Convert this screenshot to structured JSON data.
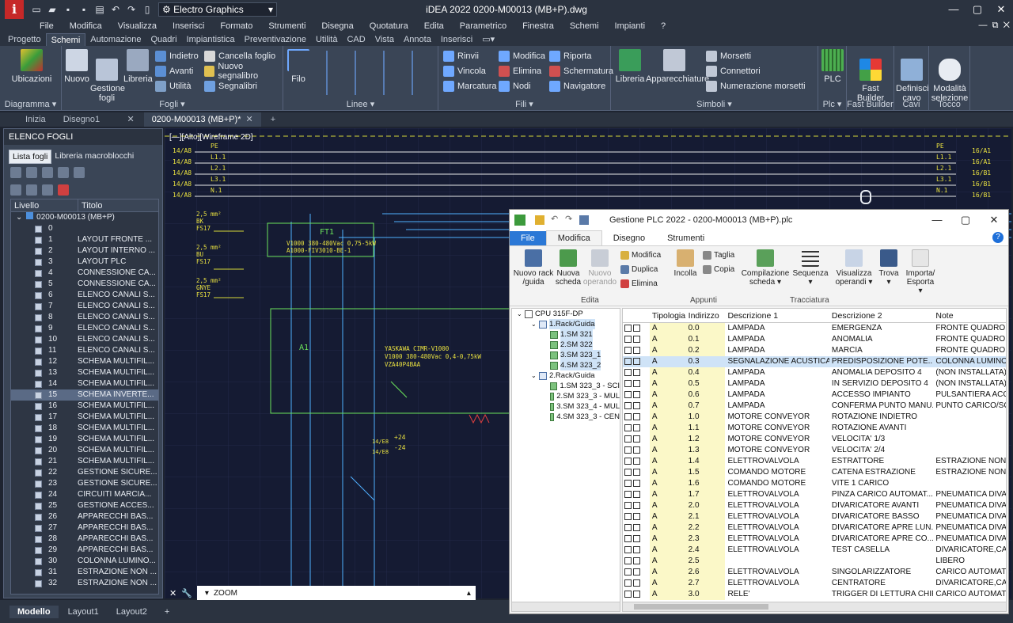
{
  "titlebar": {
    "workspace": "Electro Graphics",
    "title": "iDEA 2022    0200-M00013 (MB+P).dwg"
  },
  "menubar": [
    "File",
    "Modifica",
    "Visualizza",
    "Inserisci",
    "Formato",
    "Strumenti",
    "Disegna",
    "Quotatura",
    "Edita",
    "Parametrico",
    "Finestra",
    "Schemi",
    "Impianti",
    "?"
  ],
  "ribbon_tabs": [
    "Progetto",
    "Schemi",
    "Automazione",
    "Quadri",
    "Impiantistica",
    "Preventivazione",
    "Utilità",
    "CAD",
    "Vista",
    "Annota",
    "Inserisci"
  ],
  "ribbon": {
    "ubicazioni": "Ubicazioni",
    "diagramma": "Diagramma",
    "nuovo": "Nuovo",
    "gestione": "Gestione\nfogli",
    "libreria": "Libreria",
    "indietro": "Indietro",
    "avanti": "Avanti",
    "utilita": "Utilità",
    "cancella": "Cancella foglio",
    "nuovo_segn": "Nuovo segnalibro",
    "segnalibri": "Segnalibri",
    "fogli": "Fogli",
    "filo": "Filo",
    "linee": "Linee",
    "rinvii": "Rinvii",
    "vincola": "Vincola",
    "marcatura": "Marcatura",
    "modifica": "Modifica",
    "elimina": "Elimina",
    "nodi": "Nodi",
    "riporta": "Riporta",
    "schermatura": "Schermatura",
    "navigatore": "Navigatore",
    "fili": "Fili",
    "libreria2": "Libreria",
    "apparecchiature": "Apparecchiature",
    "morsetti": "Morsetti",
    "connettori": "Connettori",
    "numerazione": "Numerazione morsetti",
    "simboli": "Simboli",
    "plc": "PLC",
    "plc_g": "Plc",
    "fast": "Fast\nBuilder",
    "fast_g": "Fast Builder",
    "definisci": "Definisci\ncavo",
    "cavi": "Cavi",
    "modalita": "Modalità\nselezione",
    "tocco": "Tocco"
  },
  "doc_tabs": [
    "Inizia",
    "Disegno1",
    "0200-M00013 (MB+P)*"
  ],
  "left_panel": {
    "title": "ELENCO FOGLI",
    "tabs": [
      "Lista fogli",
      "Libreria macroblocchi"
    ],
    "col_livello": "Livello",
    "col_titolo": "Titolo",
    "root": "0200-M00013 (MB+P)",
    "rows": [
      [
        "0",
        ""
      ],
      [
        "1",
        "LAYOUT FRONTE ..."
      ],
      [
        "2",
        "LAYOUT INTERNO ..."
      ],
      [
        "3",
        "LAYOUT PLC"
      ],
      [
        "4",
        "CONNESSIONE CA..."
      ],
      [
        "5",
        "CONNESSIONE CA..."
      ],
      [
        "6",
        "ELENCO CANALI S..."
      ],
      [
        "7",
        "ELENCO CANALI S..."
      ],
      [
        "8",
        "ELENCO CANALI S..."
      ],
      [
        "9",
        "ELENCO CANALI S..."
      ],
      [
        "10",
        "ELENCO CANALI S..."
      ],
      [
        "11",
        "ELENCO CANALI S..."
      ],
      [
        "12",
        "SCHEMA MULTIFIL..."
      ],
      [
        "13",
        "SCHEMA MULTIFIL..."
      ],
      [
        "14",
        "SCHEMA MULTIFIL..."
      ],
      [
        "15",
        "SCHEMA INVERTE..."
      ],
      [
        "16",
        "SCHEMA MULTIFIL..."
      ],
      [
        "17",
        "SCHEMA MULTIFIL..."
      ],
      [
        "18",
        "SCHEMA MULTIFIL..."
      ],
      [
        "19",
        "SCHEMA MULTIFIL..."
      ],
      [
        "20",
        "SCHEMA MULTIFIL..."
      ],
      [
        "21",
        "SCHEMA MULTIFIL..."
      ],
      [
        "22",
        "GESTIONE SICURE..."
      ],
      [
        "23",
        "GESTIONE SICURE..."
      ],
      [
        "24",
        "CIRCUITI MARCIA..."
      ],
      [
        "25",
        "GESTIONE ACCES..."
      ],
      [
        "26",
        "APPARECCHI BAS..."
      ],
      [
        "27",
        "APPARECCHI BAS..."
      ],
      [
        "28",
        "APPARECCHI BAS..."
      ],
      [
        "29",
        "APPARECCHI BAS..."
      ],
      [
        "30",
        "COLONNA LUMINO..."
      ],
      [
        "31",
        "ESTRAZIONE NON ..."
      ],
      [
        "32",
        "ESTRAZIONE NON ..."
      ]
    ],
    "selected": "15"
  },
  "viewport": {
    "label": "[—][Alto][Wireframe 2D]"
  },
  "drawing": {
    "left_tags": [
      "14/A8",
      "14/A8",
      "14/A8",
      "14/A8",
      "14/A8"
    ],
    "left_wires": [
      "PE",
      "L1.1",
      "L2.1",
      "L3.1",
      "N.1"
    ],
    "right_tags": [
      "16/A1",
      "16/A1",
      "16/B1",
      "16/B1",
      "16/B1"
    ],
    "cable1": [
      "2,5 mm²",
      "BK",
      "FS17"
    ],
    "cable2": [
      "2,5 mm²",
      "BU",
      "FS17"
    ],
    "cable3": [
      "2,5 mm²",
      "GNYE",
      "FS17"
    ],
    "ft1": "FT1",
    "ft1_l1": "V1000 380-480Vac 0,75-5kW",
    "ft1_l2": "A1000-FIV3010-BE-1",
    "a1": "A1",
    "inv_l1": "YASKAWA CIMR-V1000",
    "inv_l2": "V1000 380-480Vac 0,4-0,75kW",
    "inv_l3": "VZA40P4BAA",
    "p24": "+24",
    "m24": "-24",
    "t24a": "14/E8",
    "t24b": "14/E8"
  },
  "command": {
    "prompt": "ZOOM"
  },
  "bottom_tabs": [
    "Modello",
    "Layout1",
    "Layout2"
  ],
  "plc": {
    "title": "Gestione PLC 2022 - 0200-M00013 (MB+P).plc",
    "menu": [
      "File",
      "Modifica",
      "Disegno",
      "Strumenti"
    ],
    "buttons": {
      "nuovo_rack": "Nuovo rack\n/guida",
      "nuova_scheda": "Nuova\nscheda",
      "nuovo_op": "Nuovo\noperando",
      "modifica": "Modifica",
      "duplica": "Duplica",
      "elimina": "Elimina",
      "edita": "Edita",
      "incolla": "Incolla",
      "taglia": "Taglia",
      "copia": "Copia",
      "appunti": "Appunti",
      "compilazione": "Compilazione\nscheda",
      "sequenza": "Sequenza",
      "tracciatura": "Tracciatura",
      "visualizza": "Visualizza\noperandi",
      "trova": "Trova",
      "importa": "Importa/\nEsporta"
    },
    "tree": [
      {
        "lvl": 0,
        "t": "CPU 315F-DP"
      },
      {
        "lvl": 1,
        "t": "1.Rack/Guida",
        "sel": true
      },
      {
        "lvl": 2,
        "t": "1.SM 321",
        "sel": true
      },
      {
        "lvl": 2,
        "t": "2.SM 322",
        "sel": true
      },
      {
        "lvl": 2,
        "t": "3.SM 323_1",
        "sel": true
      },
      {
        "lvl": 2,
        "t": "4.SM 323_2",
        "sel": true
      },
      {
        "lvl": 1,
        "t": "2.Rack/Guida"
      },
      {
        "lvl": 2,
        "t": "1.SM 323_3 - SCI"
      },
      {
        "lvl": 2,
        "t": "2.SM 323_3 - MUL"
      },
      {
        "lvl": 2,
        "t": "3.SM 323_4 - MUL"
      },
      {
        "lvl": 2,
        "t": "4.SM 323_3 - CEN"
      }
    ],
    "columns": [
      "Tipologia",
      "Indirizzo",
      "Descrizione 1",
      "Descrizione 2",
      "Note"
    ],
    "rows": [
      [
        "A",
        "0.0",
        "LAMPADA",
        "EMERGENZA",
        "FRONTE QUADRO"
      ],
      [
        "A",
        "0.1",
        "LAMPADA",
        "ANOMALIA",
        "FRONTE QUADRO"
      ],
      [
        "A",
        "0.2",
        "LAMPADA",
        "MARCIA",
        "FRONTE QUADRO"
      ],
      [
        "A",
        "0.3",
        "SEGNALAZIONE ACUSTICA",
        "PREDISPOSIZIONE POTE...",
        "COLONNA LUMINOSA"
      ],
      [
        "A",
        "0.4",
        "LAMPADA",
        "ANOMALIA DEPOSITO 4",
        "(NON INSTALLATA)"
      ],
      [
        "A",
        "0.5",
        "LAMPADA",
        "IN SERVIZIO DEPOSITO 4",
        "(NON INSTALLATA)"
      ],
      [
        "A",
        "0.6",
        "LAMPADA",
        "ACCESSO IMPIANTO",
        "PULSANTIERA ACCESSO"
      ],
      [
        "A",
        "0.7",
        "LAMPADA",
        "CONFERMA PUNTO MANU...",
        "PUNTO CARICO/SCARICO"
      ],
      [
        "A",
        "1.0",
        "MOTORE CONVEYOR",
        "ROTAZIONE INDIETRO",
        ""
      ],
      [
        "A",
        "1.1",
        "MOTORE CONVEYOR",
        "ROTAZIONE AVANTI",
        ""
      ],
      [
        "A",
        "1.2",
        "MOTORE CONVEYOR",
        "VELOCITA' 1/3",
        ""
      ],
      [
        "A",
        "1.3",
        "MOTORE CONVEYOR",
        "VELOCITA' 2/4",
        ""
      ],
      [
        "A",
        "1.4",
        "ELETTROVALVOLA",
        "ESTRATTORE",
        "ESTRAZIONE NON CONFORMI"
      ],
      [
        "A",
        "1.5",
        "COMANDO MOTORE",
        "CATENA ESTRAZIONE",
        "ESTRAZIONE NON CONFORMI"
      ],
      [
        "A",
        "1.6",
        "COMANDO MOTORE",
        "VITE 1 CARICO",
        ""
      ],
      [
        "A",
        "1.7",
        "ELETTROVALVOLA",
        "PINZA CARICO AUTOMAT...",
        "PNEUMATICA DIVARICATORE"
      ],
      [
        "A",
        "2.0",
        "ELETTROVALVOLA",
        "DIVARICATORE AVANTI",
        "PNEUMATICA DIVARICATORE"
      ],
      [
        "A",
        "2.1",
        "ELETTROVALVOLA",
        "DIVARICATORE BASSO",
        "PNEUMATICA DIVARICATORE"
      ],
      [
        "A",
        "2.2",
        "ELETTROVALVOLA",
        "DIVARICATORE APRE LUN...",
        "PNEUMATICA DIVARICATORE"
      ],
      [
        "A",
        "2.3",
        "ELETTROVALVOLA",
        "DIVARICATORE APRE CO...",
        "PNEUMATICA DIVARICATORE"
      ],
      [
        "A",
        "2.4",
        "ELETTROVALVOLA",
        "TEST CASELLA",
        "DIVARICATORE,CASELLA"
      ],
      [
        "A",
        "2.5",
        "",
        "",
        "LIBERO"
      ],
      [
        "A",
        "2.6",
        "ELETTROVALVOLA",
        "SINGOLARIZZATORE",
        "CARICO AUTOMATICO"
      ],
      [
        "A",
        "2.7",
        "ELETTROVALVOLA",
        "CENTRATORE",
        "DIVARICATORE,CASELLA"
      ],
      [
        "A",
        "3.0",
        "RELE'",
        "TRIGGER DI LETTURA CHIP",
        "CARICO AUTOMATICO"
      ]
    ],
    "selected_row": "0.3"
  }
}
